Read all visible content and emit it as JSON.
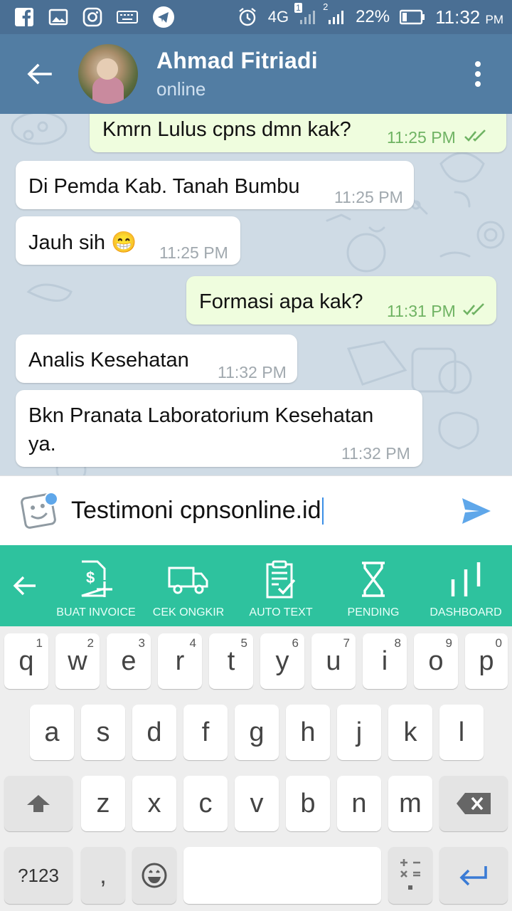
{
  "status_bar": {
    "network": "4G",
    "sim1_badge": "1",
    "sim2_badge": "2",
    "battery": "22%",
    "time": "11:32",
    "ampm": "PM"
  },
  "header": {
    "contact_name": "Ahmad Fitriadi",
    "contact_status": "online"
  },
  "messages": [
    {
      "direction": "out",
      "text": "Kmrn Lulus cpns dmn kak?",
      "time": "11:25 PM",
      "read": true
    },
    {
      "direction": "in",
      "text": "Di Pemda Kab. Tanah Bumbu",
      "time": "11:25 PM"
    },
    {
      "direction": "in",
      "text": "Jauh sih 😁",
      "time": "11:25 PM"
    },
    {
      "direction": "out",
      "text": "Formasi apa kak?",
      "time": "11:31 PM",
      "read": true
    },
    {
      "direction": "in",
      "text": "Analis Kesehatan",
      "time": "11:32 PM"
    },
    {
      "direction": "in",
      "text_line1": "Bkn Pranata Laboratorium Kesehatan",
      "text_line2": "ya.",
      "time": "11:32 PM"
    }
  ],
  "composer": {
    "text": "Testimoni cpnsonline.id"
  },
  "toolbar": {
    "items": [
      {
        "label": "BUAT INVOICE",
        "icon": "invoice-add-icon"
      },
      {
        "label": "CEK ONGKIR",
        "icon": "truck-icon"
      },
      {
        "label": "AUTO TEXT",
        "icon": "clipboard-check-icon"
      },
      {
        "label": "PENDING",
        "icon": "hourglass-icon"
      },
      {
        "label": "DASHBOARD",
        "icon": "bar-chart-icon"
      }
    ]
  },
  "keyboard": {
    "row1": [
      {
        "key": "q",
        "hint": "1"
      },
      {
        "key": "w",
        "hint": "2"
      },
      {
        "key": "e",
        "hint": "3"
      },
      {
        "key": "r",
        "hint": "4"
      },
      {
        "key": "t",
        "hint": "5"
      },
      {
        "key": "y",
        "hint": "6"
      },
      {
        "key": "u",
        "hint": "7"
      },
      {
        "key": "i",
        "hint": "8"
      },
      {
        "key": "o",
        "hint": "9"
      },
      {
        "key": "p",
        "hint": "0"
      }
    ],
    "row2": [
      "a",
      "s",
      "d",
      "f",
      "g",
      "h",
      "j",
      "k",
      "l"
    ],
    "row3": [
      "z",
      "x",
      "c",
      "v",
      "b",
      "n",
      "m"
    ],
    "symbols_label": "?123",
    "comma": ","
  },
  "colors": {
    "header": "#527da3",
    "status_bar": "#4a6f94",
    "chat_bg": "#cfdbe5",
    "outgoing_bubble": "#effdde",
    "toolbar": "#2ec29e",
    "accent_blue": "#5fa7ea"
  }
}
